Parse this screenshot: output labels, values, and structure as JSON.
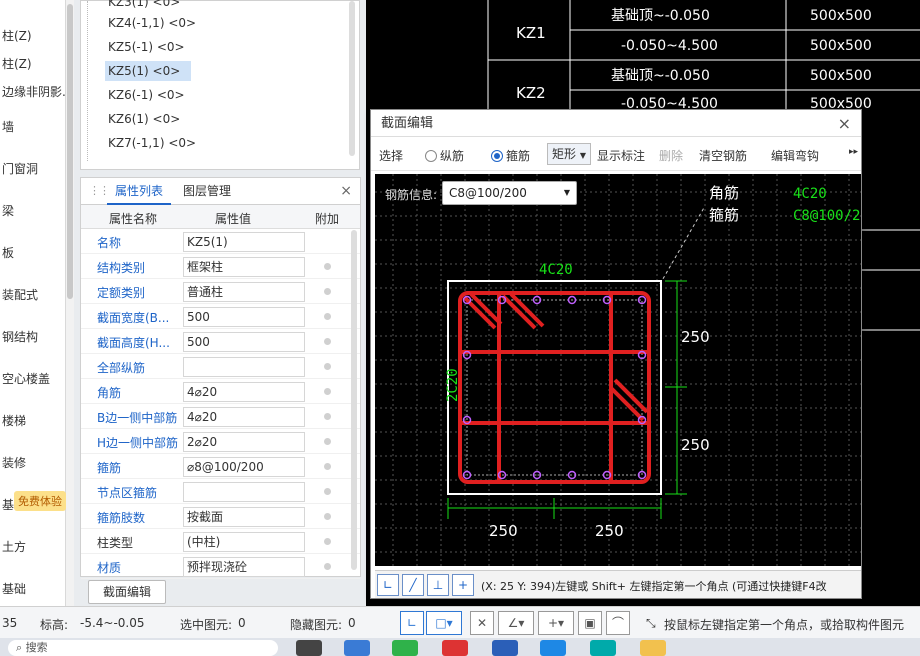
{
  "left_nav": {
    "items": [
      "柱(Z)",
      "柱(Z)",
      "边缘非阴影...",
      "墙",
      "门窗洞",
      "梁",
      "板",
      "装配式",
      "钢结构",
      "空心楼盖",
      "楼梯",
      "装修",
      "基坑支护",
      "土方",
      "基础"
    ],
    "free_badge": "免费体验"
  },
  "component_list": {
    "items": [
      {
        "label": "KZ3(1) <0>",
        "selected": false
      },
      {
        "label": "KZ4(-1,1) <0>",
        "selected": false
      },
      {
        "label": "KZ5(-1) <0>",
        "selected": false
      },
      {
        "label": "KZ5(1) <0>",
        "selected": true
      },
      {
        "label": "KZ6(-1) <0>",
        "selected": false
      },
      {
        "label": "KZ6(1) <0>",
        "selected": false
      },
      {
        "label": "KZ7(-1,1) <0>",
        "selected": false
      }
    ]
  },
  "property_panel": {
    "tab_active": "属性列表",
    "tab_other": "图层管理",
    "close": "×",
    "headers": {
      "name": "属性名称",
      "value": "属性值",
      "extra": "附加"
    },
    "rows": [
      {
        "name": "名称",
        "value": "KZ5(1)",
        "dot": false,
        "link": true
      },
      {
        "name": "结构类别",
        "value": "框架柱",
        "dot": true,
        "link": true
      },
      {
        "name": "定额类别",
        "value": "普通柱",
        "dot": true,
        "link": true
      },
      {
        "name": "截面宽度(B...",
        "value": "500",
        "dot": true,
        "link": true
      },
      {
        "name": "截面高度(H...",
        "value": "500",
        "dot": true,
        "link": true
      },
      {
        "name": "全部纵筋",
        "value": "",
        "dot": true,
        "link": true
      },
      {
        "name": "角筋",
        "value": "4⌀20",
        "dot": true,
        "link": true
      },
      {
        "name": "B边一侧中部筋",
        "value": "4⌀20",
        "dot": true,
        "link": true
      },
      {
        "name": "H边一侧中部筋",
        "value": "2⌀20",
        "dot": true,
        "link": true
      },
      {
        "name": "箍筋",
        "value": "⌀8@100/200",
        "dot": true,
        "link": true
      },
      {
        "name": "节点区箍筋",
        "value": "",
        "dot": true,
        "link": true
      },
      {
        "name": "箍筋肢数",
        "value": "按截面",
        "dot": true,
        "link": true
      },
      {
        "name": "柱类型",
        "value": "(中柱)",
        "dot": true,
        "link": false
      },
      {
        "name": "材质",
        "value": "预拌现浇砼",
        "dot": true,
        "link": true
      }
    ],
    "section_edit_button": "截面编辑"
  },
  "cad_table": {
    "rows": [
      {
        "name": "KZ1",
        "elev": "基础顶~-0.050",
        "size": "500x500"
      },
      {
        "name": "",
        "elev": "-0.050~4.500",
        "size": "500x500"
      },
      {
        "name": "KZ2",
        "elev": "基础顶~-0.050",
        "size": "500x500"
      },
      {
        "name": "",
        "elev": "-0.050~4.500",
        "size": "500x500"
      }
    ]
  },
  "dialog": {
    "title": "截面编辑",
    "close": "×",
    "toolbar": {
      "select": "选择",
      "longitudinal": "纵筋",
      "stirrup": "箍筋",
      "shape": "矩形",
      "show_label": "显示标注",
      "delete": "删除",
      "clear": "清空钢筋",
      "edit_bend": "编辑弯钩",
      "more": "▸▸"
    },
    "rebar_info_label": "钢筋信息:",
    "rebar_info_value": "C8@100/200",
    "canvas": {
      "leader_corner": "角筋",
      "leader_stirrup": "箍筋",
      "callout_corner": "4C20",
      "callout_stirrup": "C8@100/2",
      "top_label": "4C20",
      "left_label": "2C20",
      "dim_250_right_top": "250",
      "dim_250_right_bottom": "250",
      "dim_250_bottom_left": "250",
      "dim_250_bottom_right": "250"
    },
    "status_text": "(X: 25 Y: 394)左键或 Shift+ 左键指定第一个角点 (可通过快捷键F4改"
  },
  "statusbar": {
    "left_num": "35",
    "elevation_label": "标高:",
    "elevation_value": "-5.4~-0.05",
    "selected_label": "选中图元:",
    "selected_value": "0",
    "hidden_label": "隐藏图元:",
    "hidden_value": "0",
    "hint": "按鼠标左键指定第一个角点，或拾取构件图元"
  },
  "taskbar": {
    "search_text": "搜索"
  },
  "colors": {
    "cad_bg": "#000000",
    "rebar_red": "#e02020",
    "dim_green": "#19e019",
    "node_purple": "#c060ff",
    "text_blue": "#1e64c8"
  }
}
